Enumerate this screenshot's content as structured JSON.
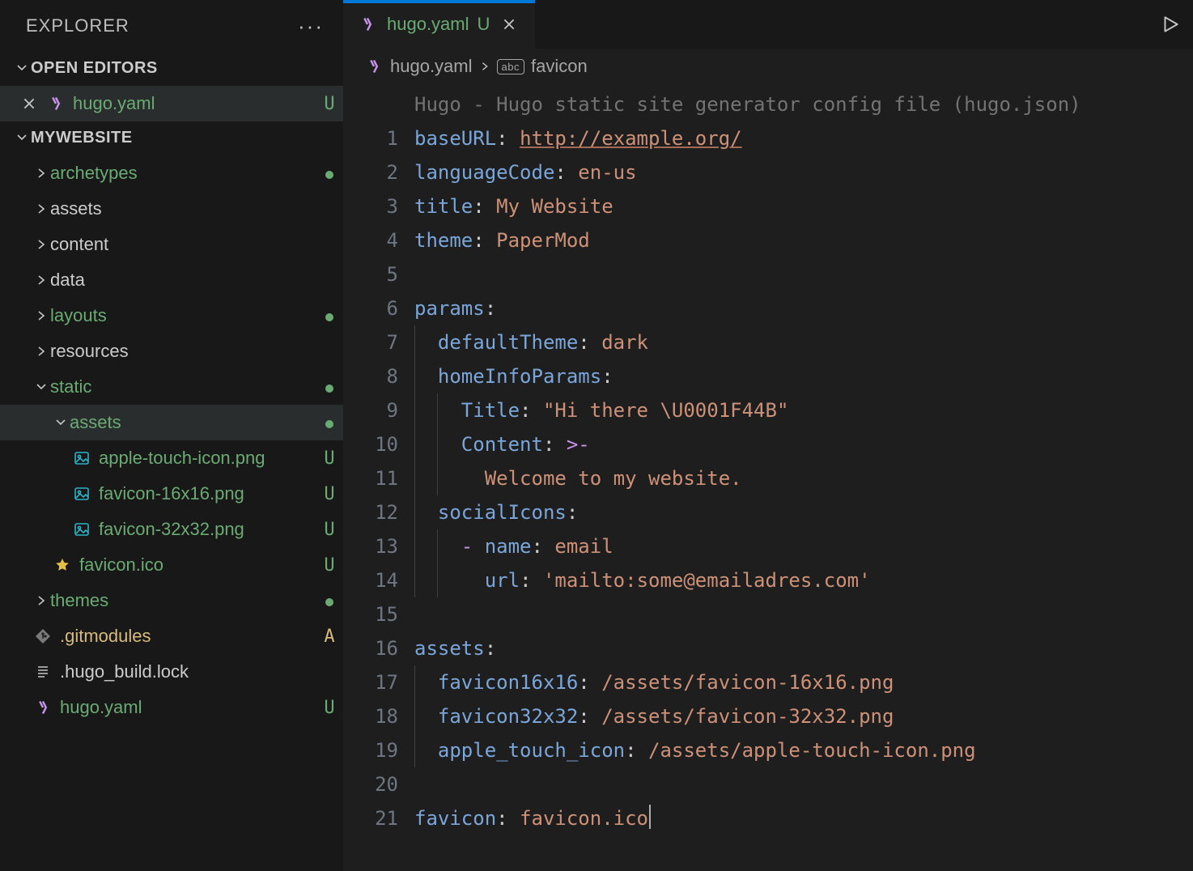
{
  "sidebar": {
    "title": "EXPLORER",
    "open_editors_label": "OPEN EDITORS",
    "open_editor": {
      "name": "hugo.yaml",
      "status": "U"
    },
    "project_label": "MYWEBSITE",
    "tree": {
      "archetypes": "archetypes",
      "assets_top": "assets",
      "content": "content",
      "data": "data",
      "layouts": "layouts",
      "resources": "resources",
      "static": "static",
      "static_assets": "assets",
      "file_appletouch": "apple-touch-icon.png",
      "file_fav16": "favicon-16x16.png",
      "file_fav32": "favicon-32x32.png",
      "file_favico": "favicon.ico",
      "themes": "themes",
      "file_gitmodules": ".gitmodules",
      "file_buildlock": ".hugo_build.lock",
      "file_hugoyaml": "hugo.yaml"
    },
    "status": {
      "u": "U",
      "a": "A"
    }
  },
  "tab": {
    "name": "hugo.yaml",
    "status": "U"
  },
  "breadcrumb": {
    "file": "hugo.yaml",
    "symbol": "favicon",
    "symbox": "abc"
  },
  "code": {
    "ghost": "Hugo - Hugo static site generator config file (hugo.json)",
    "l1_key": "baseURL",
    "l1_val": "http://example.org/",
    "l2_key": "languageCode",
    "l2_val": "en-us",
    "l3_key": "title",
    "l3_val": "My Website",
    "l4_key": "theme",
    "l4_val": "PaperMod",
    "l6_key": "params",
    "l7_key": "defaultTheme",
    "l7_val": "dark",
    "l8_key": "homeInfoParams",
    "l9_key": "Title",
    "l9_val": "\"Hi there \\U0001F44B\"",
    "l10_key": "Content",
    "l10_op": ">-",
    "l11_val": "Welcome to my website.",
    "l12_key": "socialIcons",
    "l13_key": "name",
    "l13_val": "email",
    "l14_key": "url",
    "l14_val": "'mailto:some@emailadres.com'",
    "l16_key": "assets",
    "l17_key": "favicon16x16",
    "l17_val": "/assets/favicon-16x16.png",
    "l18_key": "favicon32x32",
    "l18_val": "/assets/favicon-32x32.png",
    "l19_key": "apple_touch_icon",
    "l19_val": "/assets/apple-touch-icon.png",
    "l21_key": "favicon",
    "l21_val": "favicon.ico"
  },
  "linenums": [
    "1",
    "2",
    "3",
    "4",
    "5",
    "6",
    "7",
    "8",
    "9",
    "10",
    "11",
    "12",
    "13",
    "14",
    "15",
    "16",
    "17",
    "18",
    "19",
    "20",
    "21"
  ]
}
